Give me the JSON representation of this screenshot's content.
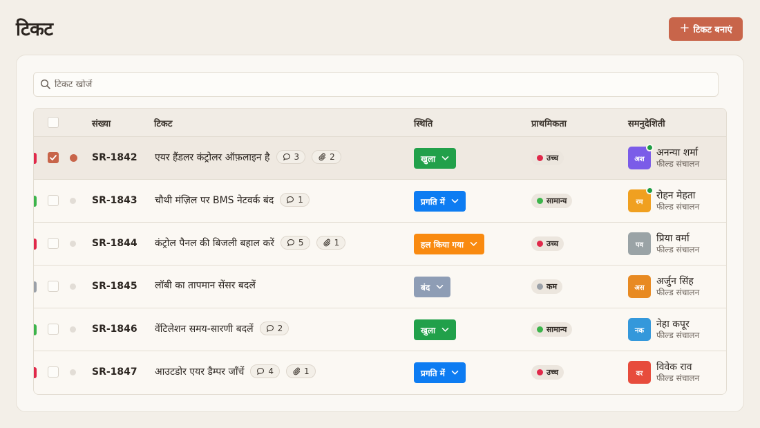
{
  "page": {
    "title": "टिकट",
    "create_label": "टिकट बनाएं"
  },
  "search": {
    "placeholder": "टिकट खोजें"
  },
  "table": {
    "columns": {
      "number": "संख्या",
      "ticket": "टिकट",
      "status": "स्थिति",
      "priority": "प्राथमिकता",
      "assignee": "समनुदेशिती"
    },
    "rows": [
      {
        "number": "SR-1842",
        "title": "एयर हैंडलर कंट्रोलर ऑफ़लाइन है",
        "comments": "3",
        "attachments": "2",
        "status": "खुला",
        "status_color": "#21a04a",
        "priority": "उच्च",
        "priority_color": "#e0294a",
        "edge_color": "#e0294a",
        "selected": true,
        "assignee_initials": "अश",
        "assignee_name": "अनन्या शर्मा",
        "assignee_team": "फील्ड संचालन",
        "avatar_color": "#7b5ce8",
        "online": true
      },
      {
        "number": "SR-1843",
        "title": "चौथी मंज़िल पर BMS नेटवर्क बंद",
        "comments": "1",
        "attachments": "",
        "status": "प्रगति में",
        "status_color": "#0d7cf2",
        "priority": "सामान्य",
        "priority_color": "#3cb44b",
        "edge_color": "#3cb44b",
        "selected": false,
        "assignee_initials": "रम",
        "assignee_name": "रोहन मेहता",
        "assignee_team": "फील्ड संचालन",
        "avatar_color": "#f0a020",
        "online": true
      },
      {
        "number": "SR-1844",
        "title": "कंट्रोल पैनल की बिजली बहाल करें",
        "comments": "5",
        "attachments": "1",
        "status": "हल किया गया",
        "status_color": "#f98a10",
        "priority": "उच्च",
        "priority_color": "#e0294a",
        "edge_color": "#e0294a",
        "selected": false,
        "assignee_initials": "पव",
        "assignee_name": "प्रिया वर्मा",
        "assignee_team": "फील्ड संचालन",
        "avatar_color": "#9aa3a6",
        "online": false
      },
      {
        "number": "SR-1845",
        "title": "लॉबी का तापमान सेंसर बदलें",
        "comments": "",
        "attachments": "",
        "status": "बंद",
        "status_color": "#8e9db5",
        "priority": "कम",
        "priority_color": "#9aa0a8",
        "edge_color": "#9aa0a8",
        "selected": false,
        "assignee_initials": "अस",
        "assignee_name": "अर्जुन सिंह",
        "assignee_team": "फील्ड संचालन",
        "avatar_color": "#e88a22",
        "online": false
      },
      {
        "number": "SR-1846",
        "title": "वेंटिलेशन समय-सारणी बदलें",
        "comments": "2",
        "attachments": "",
        "status": "खुला",
        "status_color": "#21a04a",
        "priority": "सामान्य",
        "priority_color": "#3cb44b",
        "edge_color": "#3cb44b",
        "selected": false,
        "assignee_initials": "नक",
        "assignee_name": "नेहा कपूर",
        "assignee_team": "फील्ड संचालन",
        "avatar_color": "#3498db",
        "online": false
      },
      {
        "number": "SR-1847",
        "title": "आउटडोर एयर डैम्पर जाँचें",
        "comments": "4",
        "attachments": "1",
        "status": "प्रगति में",
        "status_color": "#0d7cf2",
        "priority": "उच्च",
        "priority_color": "#e0294a",
        "edge_color": "#e0294a",
        "selected": false,
        "assignee_initials": "वर",
        "assignee_name": "विवेक राव",
        "assignee_team": "फील्ड संचालन",
        "avatar_color": "#e74c3c",
        "online": false
      }
    ]
  },
  "icons": {
    "search": "search-icon",
    "plus": "plus-icon",
    "comment": "comment-icon",
    "attachment": "paperclip-icon",
    "chevron": "chevron-down-icon",
    "check": "check-icon"
  }
}
